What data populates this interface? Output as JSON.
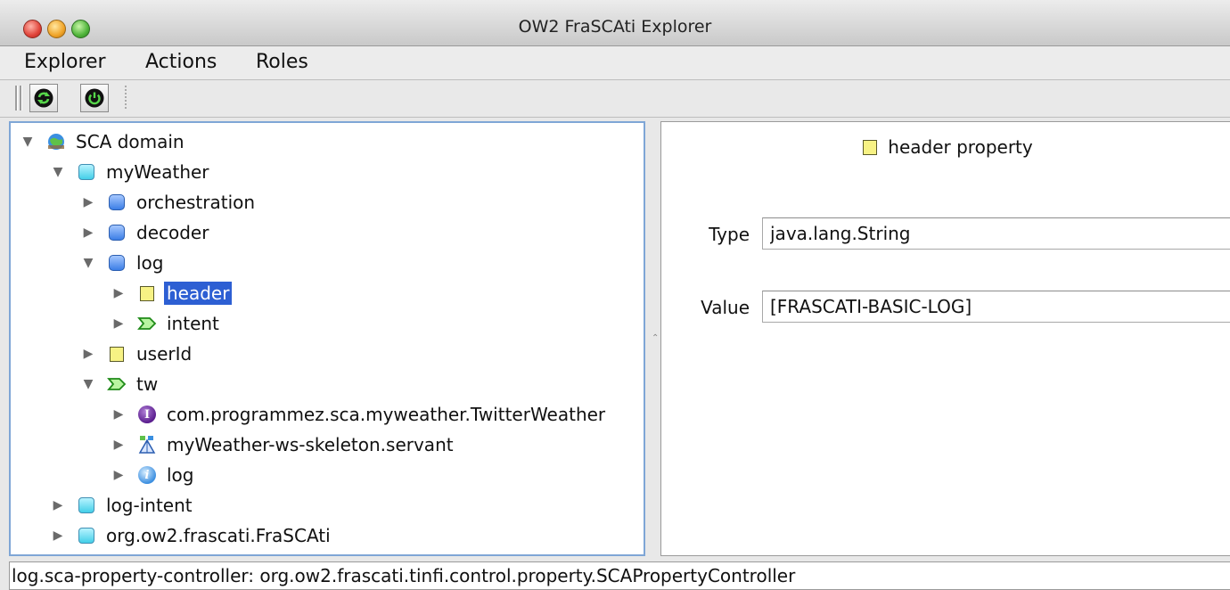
{
  "window": {
    "title": "OW2 FraSCAti Explorer"
  },
  "menubar": {
    "items": [
      "Explorer",
      "Actions",
      "Roles"
    ]
  },
  "toolbar": {
    "buttons": [
      {
        "icon": "refresh-icon"
      },
      {
        "icon": "power-icon"
      }
    ]
  },
  "tree": {
    "nodes": [
      {
        "label": "SCA domain",
        "icon": "globe-icon",
        "expanded": true
      },
      {
        "label": "myWeather",
        "icon": "composite-icon",
        "expanded": true
      },
      {
        "label": "orchestration",
        "icon": "component-icon",
        "expanded": false
      },
      {
        "label": "decoder",
        "icon": "component-icon",
        "expanded": false
      },
      {
        "label": "log",
        "icon": "component-icon",
        "expanded": true
      },
      {
        "label": "header",
        "icon": "property-icon",
        "expanded": false,
        "selected": true
      },
      {
        "label": "intent",
        "icon": "service-icon",
        "expanded": false
      },
      {
        "label": "userId",
        "icon": "property-icon",
        "expanded": false
      },
      {
        "label": "tw",
        "icon": "service-icon",
        "expanded": true
      },
      {
        "label": "com.programmez.sca.myweather.TwitterWeather",
        "icon": "interface-icon",
        "expanded": false
      },
      {
        "label": "myWeather-ws-skeleton.servant",
        "icon": "binding-icon",
        "expanded": false
      },
      {
        "label": "log",
        "icon": "info-icon",
        "expanded": false
      },
      {
        "label": "log-intent",
        "icon": "composite-icon",
        "expanded": false
      },
      {
        "label": "org.ow2.frascati.FraSCAti",
        "icon": "composite-icon",
        "expanded": false
      }
    ]
  },
  "detail": {
    "header": "header property",
    "type_label": "Type",
    "type_value": "java.lang.String",
    "value_label": "Value",
    "value_value": "[FRASCATI-BASIC-LOG]"
  },
  "status": {
    "text": "log.sca-property-controller: org.ow2.frascati.tinfi.control.property.SCAPropertyController"
  },
  "colors": {
    "selection": "#2d5fd3",
    "tree_border": "#7fa6d6",
    "property_yellow": "#f7f284",
    "service_green": "#48c735",
    "interface_purple": "#5a1d8e"
  }
}
